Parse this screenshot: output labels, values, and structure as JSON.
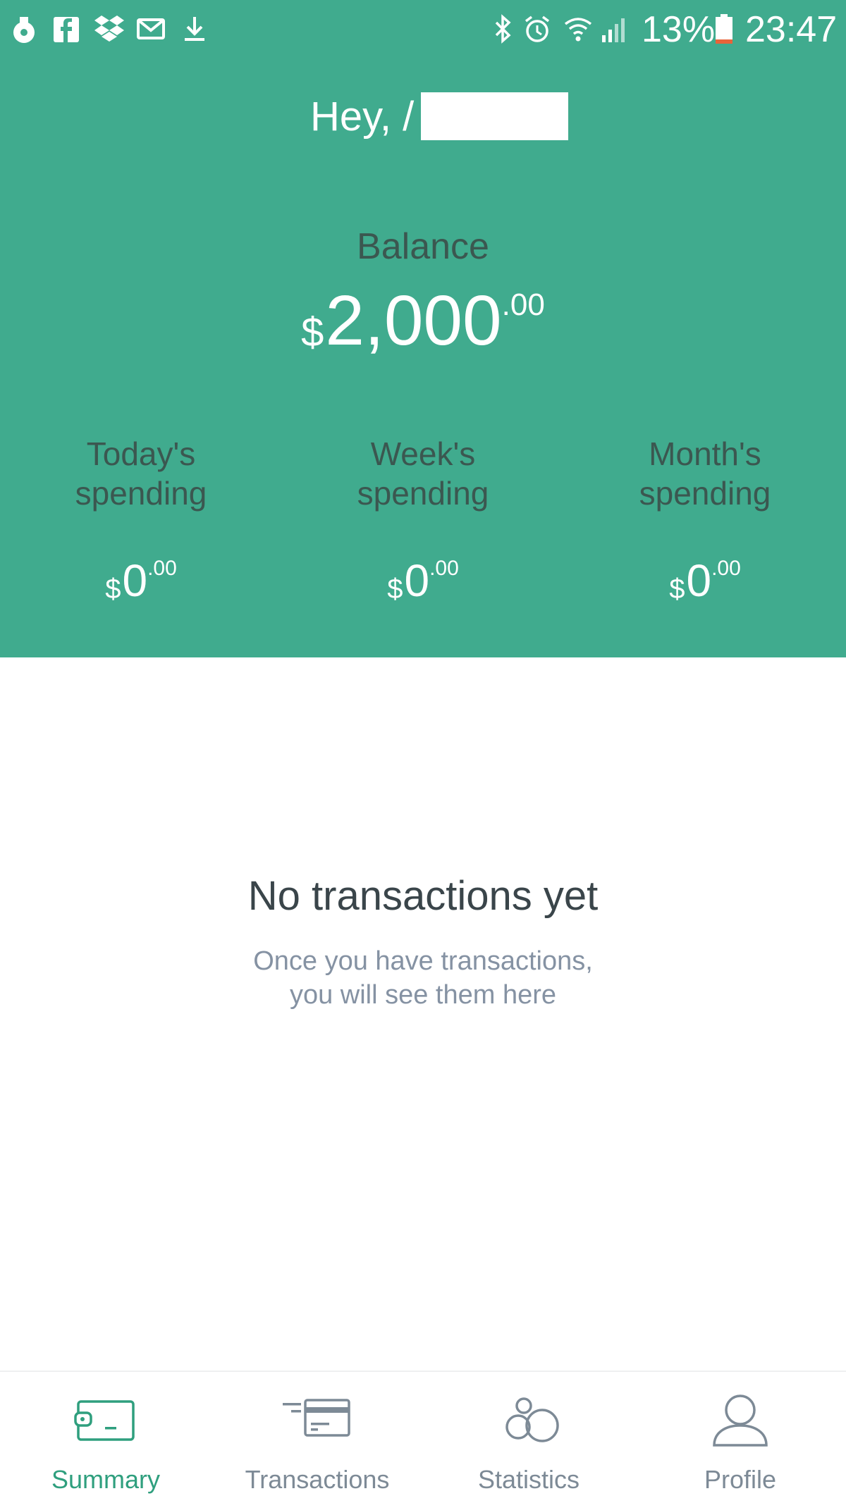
{
  "status_bar": {
    "battery_percent": "13%",
    "time": "23:47",
    "icons": [
      "notification-icon",
      "facebook-icon",
      "dropbox-icon",
      "mail-icon",
      "download-icon",
      "bluetooth-icon",
      "alarm-icon",
      "wifi-icon",
      "signal-icon",
      "battery-icon"
    ]
  },
  "header": {
    "greeting": "Hey, /",
    "balance_label": "Balance",
    "balance": {
      "currency": "$",
      "whole": "2,000",
      "cents": ".00"
    },
    "spending": [
      {
        "label_line1": "Today's",
        "label_line2": "spending",
        "currency": "$",
        "whole": "0",
        "cents": ".00"
      },
      {
        "label_line1": "Week's",
        "label_line2": "spending",
        "currency": "$",
        "whole": "0",
        "cents": ".00"
      },
      {
        "label_line1": "Month's",
        "label_line2": "spending",
        "currency": "$",
        "whole": "0",
        "cents": ".00"
      }
    ]
  },
  "empty_state": {
    "title": "No transactions yet",
    "subtitle_line1": "Once you have transactions,",
    "subtitle_line2": "you will see them here"
  },
  "bottom_nav": {
    "items": [
      {
        "label": "Summary",
        "icon": "wallet-icon",
        "active": true
      },
      {
        "label": "Transactions",
        "icon": "card-icon",
        "active": false
      },
      {
        "label": "Statistics",
        "icon": "bubbles-icon",
        "active": false
      },
      {
        "label": "Profile",
        "icon": "person-icon",
        "active": false
      }
    ]
  },
  "colors": {
    "header_bg": "#40ab8e",
    "accent": "#2f9f7e",
    "label_dark": "#3b5750",
    "muted": "#8592a3"
  }
}
